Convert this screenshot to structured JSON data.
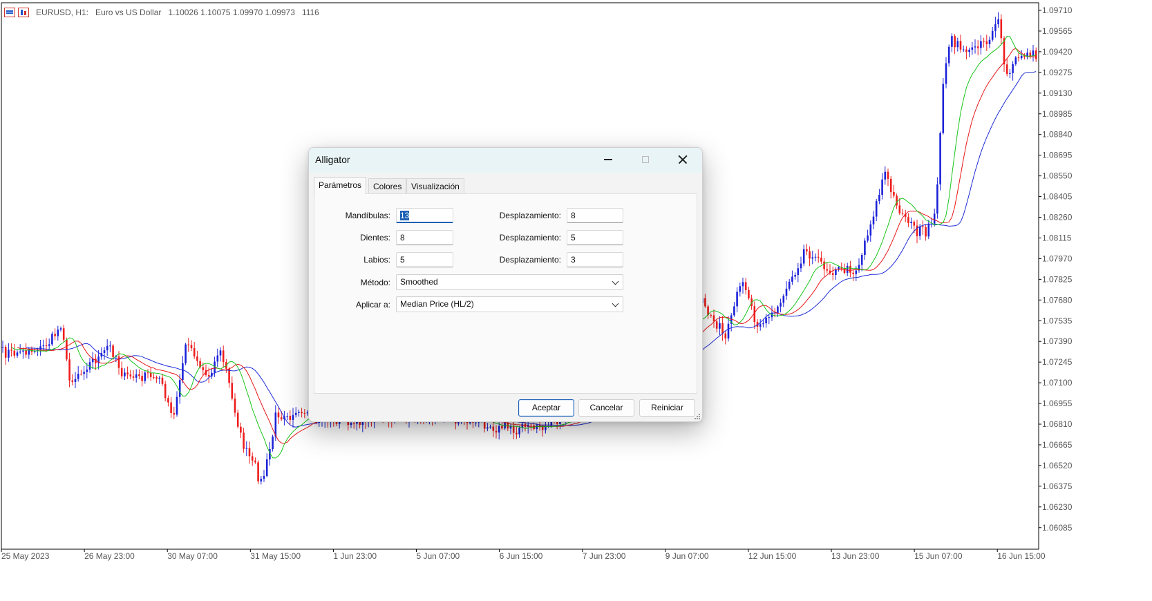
{
  "chart": {
    "symbol": "EURUSD, H1:",
    "description": "Euro vs US Dollar",
    "ohlc": "1.10026 1.10075 1.09970 1.09973",
    "volume": "1116",
    "price_labels": [
      "1.09710",
      "1.09565",
      "1.09420",
      "1.09275",
      "1.09130",
      "1.08985",
      "1.08840",
      "1.08695",
      "1.08550",
      "1.08405",
      "1.08260",
      "1.08115",
      "1.07970",
      "1.07825",
      "1.07680",
      "1.07535",
      "1.07390",
      "1.07245",
      "1.07100",
      "1.06955",
      "1.06810",
      "1.06665",
      "1.06520",
      "1.06375",
      "1.06230",
      "1.06085"
    ],
    "time_labels": [
      "25 May 2023",
      "26 May 23:00",
      "30 May 07:00",
      "31 May 15:00",
      "1 Jun 23:00",
      "5 Jun 07:00",
      "6 Jun 15:00",
      "7 Jun 23:00",
      "9 Jun 07:00",
      "12 Jun 15:00",
      "13 Jun 23:00",
      "15 Jun 07:00",
      "16 Jun 15:00"
    ],
    "colors": {
      "bull": "#1b22d8",
      "bear": "#ee1c1c",
      "jaw": "#1d2bd6",
      "teeth": "#e81616",
      "lips": "#18c41a",
      "axis_text": "#555555"
    }
  },
  "dialog": {
    "title": "Alligator",
    "tabs": [
      {
        "label": "Parámetros",
        "active": true
      },
      {
        "label": "Colores",
        "active": false
      },
      {
        "label": "Visualización",
        "active": false
      }
    ],
    "fields": {
      "jaws_label": "Mandíbulas:",
      "jaws_value": "13",
      "jaws_shift_label": "Desplazamiento:",
      "jaws_shift_value": "8",
      "teeth_label": "Dientes:",
      "teeth_value": "8",
      "teeth_shift_label": "Desplazamiento:",
      "teeth_shift_value": "5",
      "lips_label": "Labios:",
      "lips_value": "5",
      "lips_shift_label": "Desplazamiento:",
      "lips_shift_value": "3",
      "method_label": "Método:",
      "method_value": "Smoothed",
      "apply_label": "Aplicar a:",
      "apply_value": "Median Price (HL/2)"
    },
    "buttons": {
      "ok": "Aceptar",
      "cancel": "Cancelar",
      "reset": "Reiniciar"
    }
  }
}
